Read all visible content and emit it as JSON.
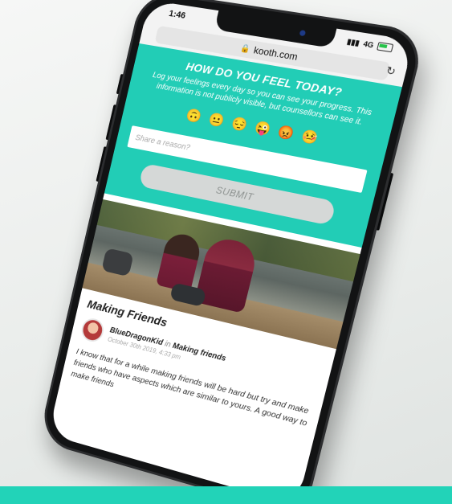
{
  "status_bar": {
    "time": "1:46",
    "network": "4G"
  },
  "browser": {
    "url": "kooth.com"
  },
  "mood": {
    "title": "HOW DO YOU FEEL TODAY?",
    "description": "Log your feelings every day so you can see your progress. This information is not publicly visible, but counsellors can see it.",
    "emojis": [
      "🙃",
      "😐",
      "😔",
      "😜",
      "😡",
      "🤒"
    ],
    "reason_placeholder": "Share a reason?",
    "submit_label": "SUBMIT"
  },
  "article": {
    "title": "Making Friends",
    "author": "BlueDragonKid",
    "in_word": "in",
    "topic": "Making friends",
    "date": "October 30th 2019, 4:33 pm",
    "body": "I know that for a while making friends will be hard but try and make friends who have aspects which are similar to yours. A good way to make friends"
  },
  "colors": {
    "accent": "#22cdb6",
    "strip": "#22d3b8"
  }
}
